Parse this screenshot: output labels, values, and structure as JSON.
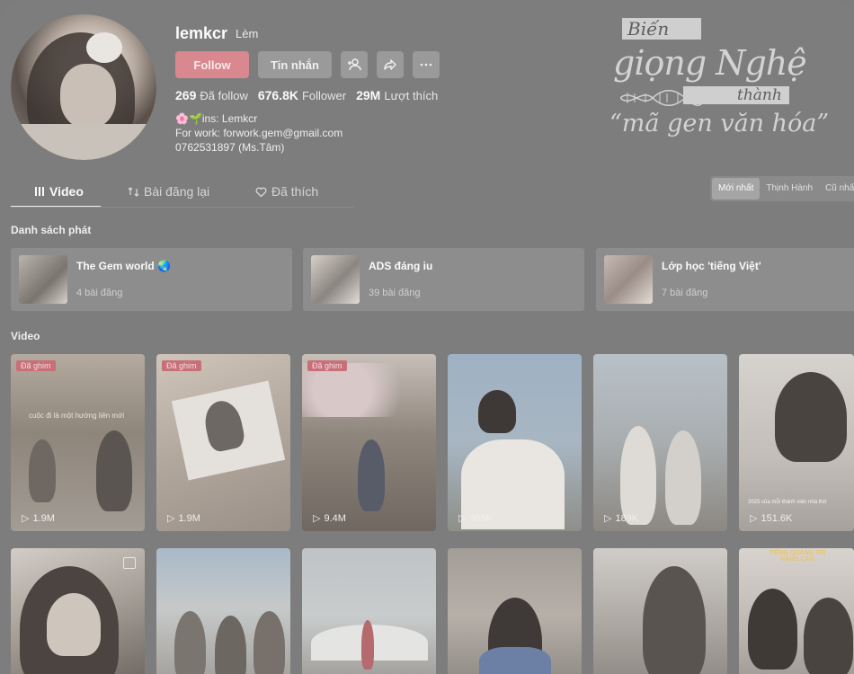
{
  "profile": {
    "username": "lemkcr",
    "nickname": "Lèm",
    "follow_label": "Follow",
    "message_label": "Tin nhắn",
    "stats": [
      {
        "value": "269",
        "label": "Đã follow"
      },
      {
        "value": "676.8K",
        "label": "Follower"
      },
      {
        "value": "29M",
        "label": "Lượt thích"
      }
    ],
    "bio": [
      "🌸🌱ins: Lemkcr",
      "For work: forwork.gem@gmail.com",
      "0762531897 (Ms.Tâm)"
    ]
  },
  "banner": {
    "line1": "Biến",
    "line2": "giọng Nghệ",
    "line3": "thành",
    "line4": "“mã gen văn hóa”"
  },
  "tabs": [
    {
      "label": "Video",
      "icon": "grid-icon"
    },
    {
      "label": "Bài đăng lại",
      "icon": "repost-icon"
    },
    {
      "label": "Đã thích",
      "icon": "heart-icon"
    }
  ],
  "sort_options": [
    "Mới nhất",
    "Thịnh Hành",
    "Cũ nhất"
  ],
  "playlists_title": "Danh sách phát",
  "playlists": [
    {
      "title": "The Gem world 🌏",
      "count": "4 bài đăng"
    },
    {
      "title": "ADS đáng iu",
      "count": "39 bài đăng"
    },
    {
      "title": "Lớp học 'tiếng Việt'",
      "count": "7 bài đăng"
    }
  ],
  "videos_title": "Video",
  "videos": [
    {
      "pinned": "Đã ghim",
      "views": "1.9M"
    },
    {
      "pinned": "Đã ghim",
      "views": "1.9M"
    },
    {
      "pinned": "Đã ghim",
      "views": "9.4M"
    },
    {
      "pinned": "",
      "views": "365K"
    },
    {
      "pinned": "",
      "views": "189K"
    },
    {
      "pinned": "",
      "views": "151.6K"
    }
  ],
  "video_captions": {
    "v1": "cuộc đi là một hướng liên mới",
    "v6": "2025 của mỗi thành viên nhà thờ",
    "r2v6": "TIẾNG QUẢNG TRỊ NÂNG CAO"
  },
  "colors": {
    "background": "#7d7d7d",
    "follow_button": "#d9888f",
    "pinned_badge": "#c77078"
  }
}
